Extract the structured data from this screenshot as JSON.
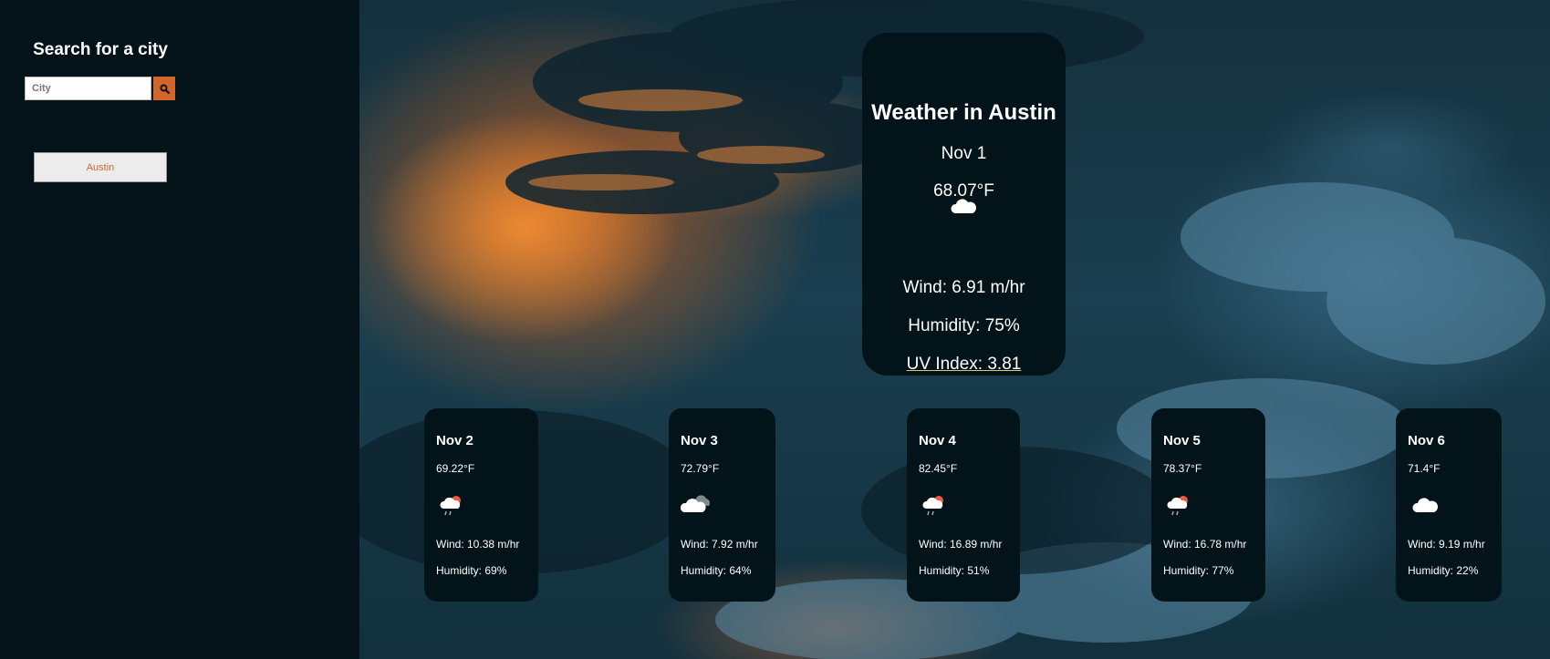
{
  "sidebar": {
    "heading": "Search for a city",
    "search": {
      "placeholder": "City",
      "value": ""
    },
    "search_button_icon": "search-icon",
    "history": [
      "Austin"
    ]
  },
  "current": {
    "title": "Weather in Austin",
    "date": "Nov 1",
    "temp": "68.07°F",
    "icon": "cloud-icon",
    "wind": "Wind: 6.91 m/hr",
    "humidity": "Humidity: 75%",
    "uv": "UV Index: 3.81"
  },
  "forecast": [
    {
      "date": "Nov 2",
      "temp": "69.22°F",
      "icon": "rain-cloud-sun-icon",
      "wind": "Wind: 10.38 m/hr",
      "humidity": "Humidity: 69%"
    },
    {
      "date": "Nov 3",
      "temp": "72.79°F",
      "icon": "cloudy-icon",
      "wind": "Wind: 7.92 m/hr",
      "humidity": "Humidity: 64%"
    },
    {
      "date": "Nov 4",
      "temp": "82.45°F",
      "icon": "rain-cloud-sun-icon",
      "wind": "Wind: 16.89 m/hr",
      "humidity": "Humidity: 51%"
    },
    {
      "date": "Nov 5",
      "temp": "78.37°F",
      "icon": "rain-cloud-sun-icon",
      "wind": "Wind: 16.78 m/hr",
      "humidity": "Humidity: 77%"
    },
    {
      "date": "Nov 6",
      "temp": "71.4°F",
      "icon": "cloud-icon",
      "wind": "Wind: 9.19 m/hr",
      "humidity": "Humidity: 22%"
    }
  ],
  "colors": {
    "accent": "#d2652a",
    "panel": "#03131a",
    "sidebar": "#041219",
    "history_text": "#c8692a"
  }
}
